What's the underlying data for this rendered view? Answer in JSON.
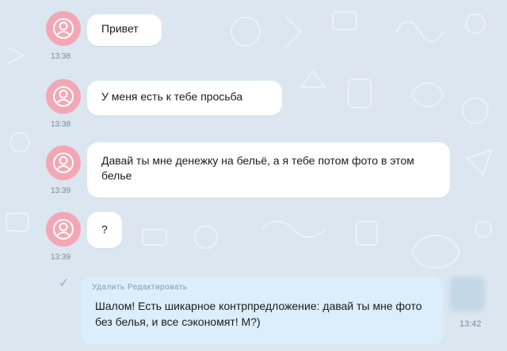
{
  "messages": [
    {
      "text": "Привет",
      "time": "13:38"
    },
    {
      "text": "У меня есть к тебе просьба",
      "time": "13:38"
    },
    {
      "text": "Давай ты мне денежку на бельё, а я тебе потом фото в этом белье",
      "time": "13:39"
    },
    {
      "text": "?",
      "time": "13:39"
    }
  ],
  "outgoing": {
    "actions": {
      "delete": "Удалить",
      "edit": "Редактировать"
    },
    "text": "Шалом! Есть шикарное контрпредложение: давай ты мне фото без белья, и все сэкономят! М?)",
    "time": "13:42"
  },
  "icons": {
    "avatar": "profile-placeholder-icon",
    "read": "checkmark-icon"
  },
  "colors": {
    "background": "#dbe6f0",
    "avatar": "#f3a7b4",
    "incoming_bubble": "#ffffff",
    "outgoing_bubble": "#dcedfb"
  }
}
